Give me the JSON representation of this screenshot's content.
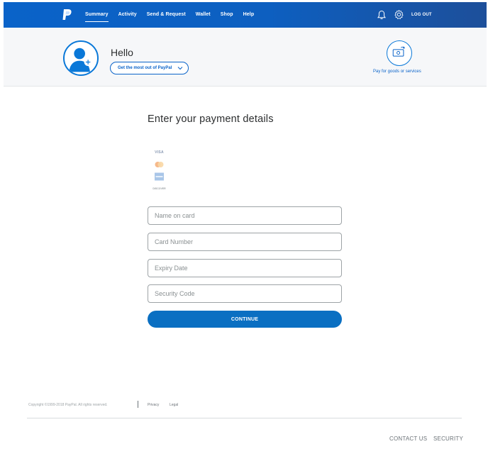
{
  "nav": {
    "items": [
      {
        "label": "Summary",
        "active": true
      },
      {
        "label": "Activity",
        "active": false
      },
      {
        "label": "Send & Request",
        "active": false
      },
      {
        "label": "Wallet",
        "active": false
      },
      {
        "label": "Shop",
        "active": false
      },
      {
        "label": "Help",
        "active": false
      }
    ],
    "logout_label": "LOG OUT",
    "icons": [
      "paypal-logo-icon",
      "bell-icon",
      "gear-icon"
    ]
  },
  "hello": {
    "greeting": "Hello",
    "get_most_label": "Get the most out of PayPal",
    "pay_label": "Pay for goods or services"
  },
  "form": {
    "title": "Enter your payment details",
    "card_logos": [
      "VISA",
      "mastercard",
      "amex",
      "DISCOVER"
    ],
    "name_placeholder": "Name on card",
    "number_placeholder": "Card Number",
    "expiry_placeholder": "Expiry Date",
    "security_placeholder": "Security Code",
    "continue_label": "CONTINUE"
  },
  "footer": {
    "copyright": "Copyright ©1999-2018 PayPal. All rights reserved.",
    "privacy": "Privacy",
    "legal": "Legal",
    "contact": "CONTACT US",
    "security": "SECURITY"
  },
  "colors": {
    "brand_blue": "#0a63c9",
    "button_blue": "#0a6fc2",
    "hello_band_bg": "#f6f7f9"
  }
}
